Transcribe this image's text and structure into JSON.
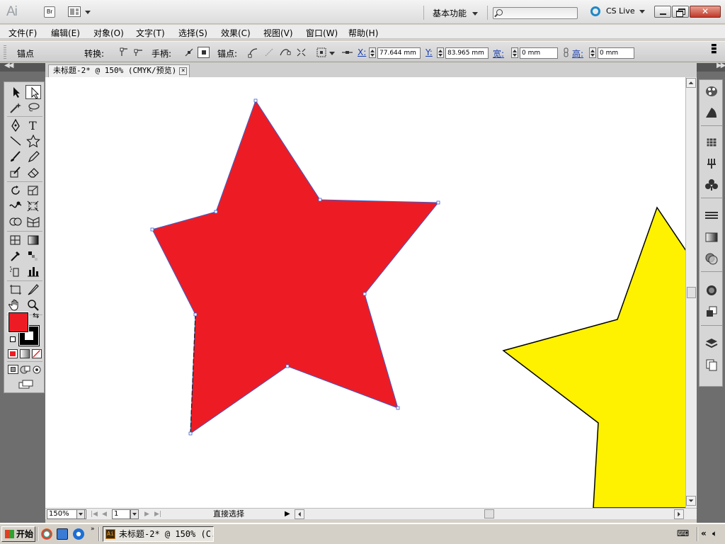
{
  "app": {
    "logo": "Ai",
    "bridge_label": "Br",
    "workspace": "基本功能",
    "search_placeholder": "",
    "cs_live": "CS Live"
  },
  "menu": [
    "文件(F)",
    "编辑(E)",
    "对象(O)",
    "文字(T)",
    "选择(S)",
    "效果(C)",
    "视图(V)",
    "窗口(W)",
    "帮助(H)"
  ],
  "control": {
    "anchor_label": "锚点",
    "convert_label": "转换:",
    "handles_label": "手柄:",
    "anchors_label": "锚点:",
    "x_label": "X:",
    "x_value": "77.644 mm",
    "y_label": "Y:",
    "y_value": "83.965 mm",
    "w_label": "宽:",
    "w_value": "0 mm",
    "h_label": "高:",
    "h_value": "0 mm"
  },
  "document": {
    "tab_title": "未标题-2* @ 150% (CMYK/预览)",
    "close": "×"
  },
  "canvas": {
    "red_star_color": "#ed1c24",
    "yellow_star_color": "#fff200",
    "path_color": "#3a5fd0"
  },
  "statusbar": {
    "zoom": "150%",
    "page": "1",
    "tool_status": "直接选择"
  },
  "colors": {
    "fill": "#ed1c24",
    "stroke": "#000000"
  },
  "taskbar": {
    "start": "开始",
    "active_window": "未标题-2* @ 150% (C..."
  }
}
